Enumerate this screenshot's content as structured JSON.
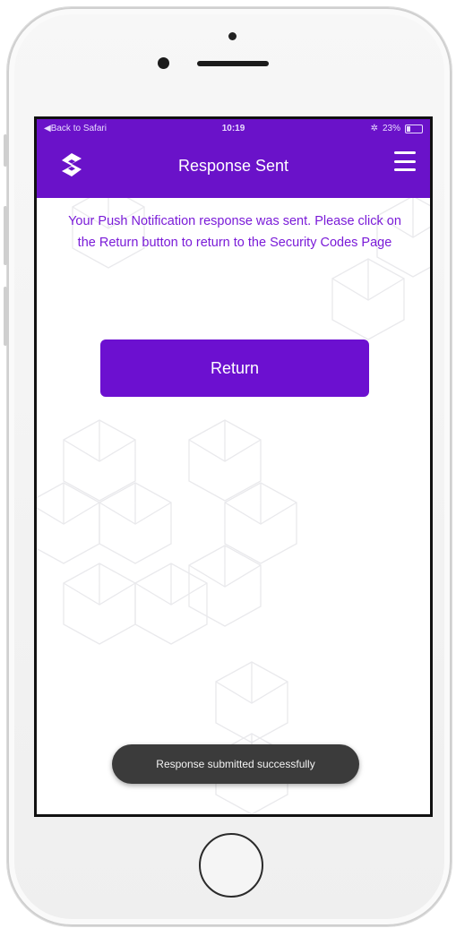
{
  "status_bar": {
    "back_label": "◀Back to Safari",
    "time": "10:19",
    "battery": "23%"
  },
  "nav": {
    "title": "Response Sent",
    "logo_icon": "app-logo-icon",
    "menu_icon": "hamburger-menu-icon"
  },
  "content": {
    "message": "Your Push Notification response was sent. Please click on the Return button to return to the Security Codes Page",
    "return_label": "Return"
  },
  "toast": {
    "text": "Response submitted successfully"
  },
  "colors": {
    "brand": "#6a12c9",
    "message_text": "#7a1bd8",
    "toast_bg": "#3b3b3b"
  }
}
